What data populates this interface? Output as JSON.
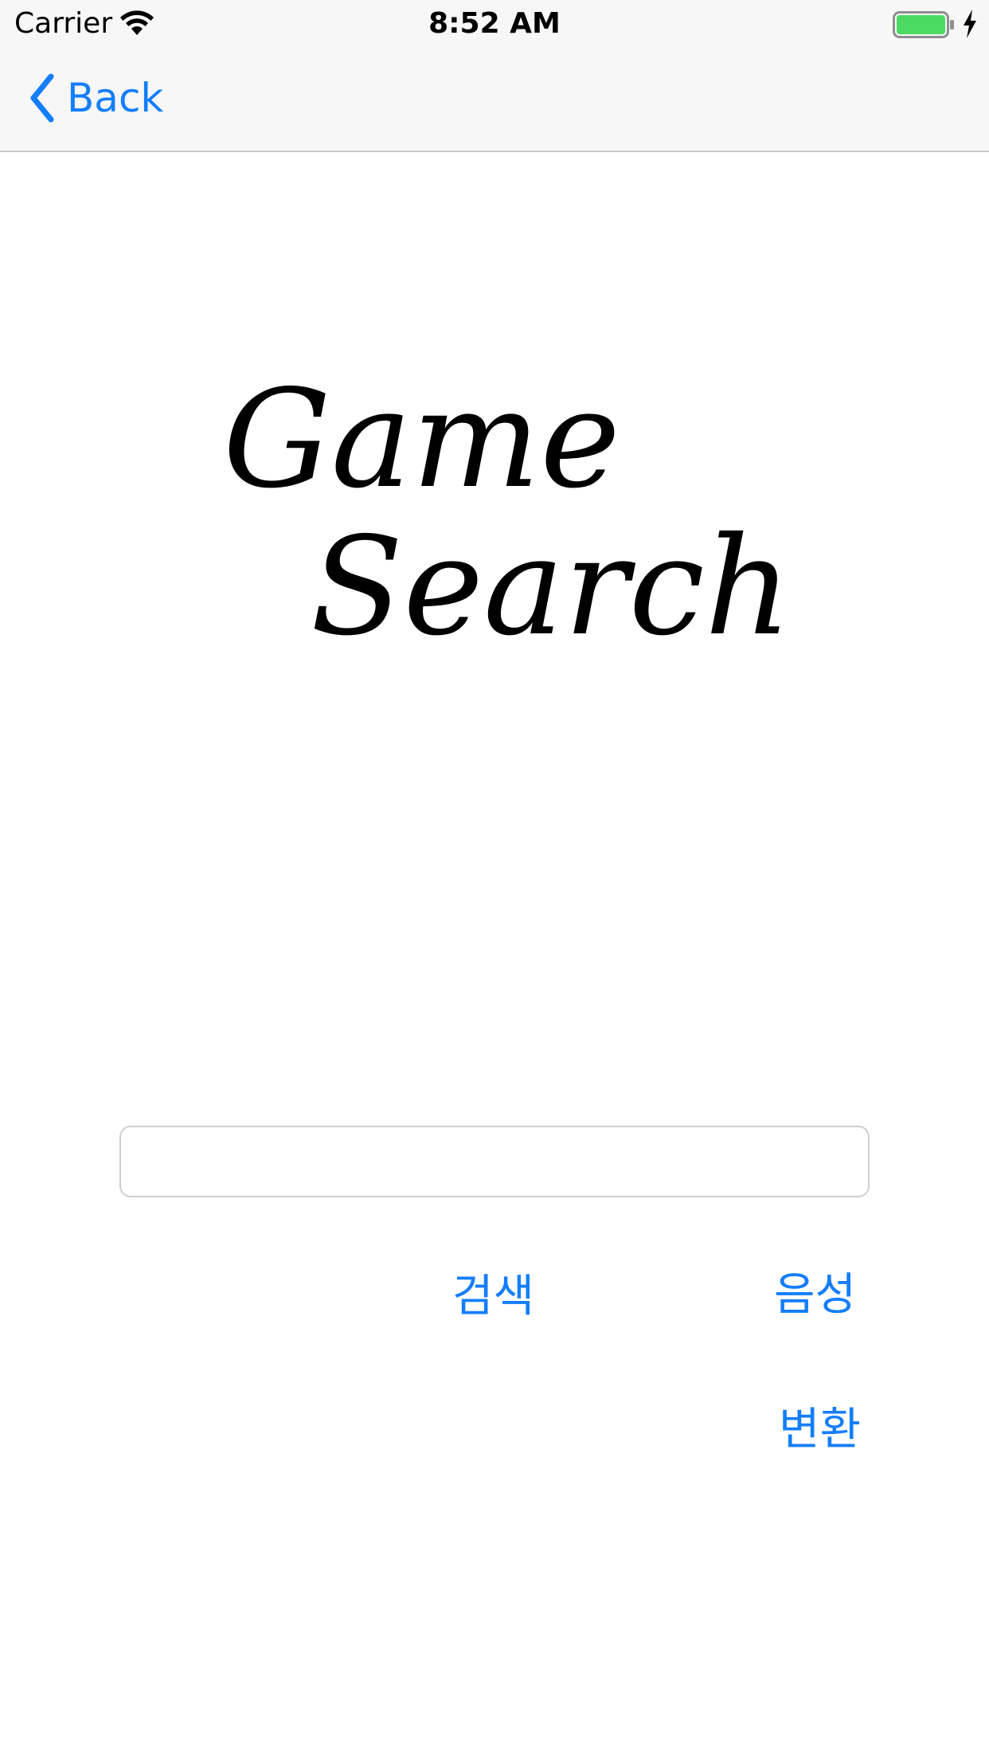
{
  "status_bar": {
    "carrier": "Carrier",
    "time": "8:52 AM",
    "wifi_icon": "wifi-icon",
    "battery_icon": "battery-full-icon",
    "charging_icon": "charging-bolt-icon",
    "battery_color": "#4cd964"
  },
  "nav": {
    "back_label": "Back",
    "back_icon": "chevron-left-icon",
    "accent_color": "#147efb"
  },
  "logo": {
    "line1": "Game",
    "line2": "Search"
  },
  "search": {
    "value": "",
    "placeholder": ""
  },
  "buttons": {
    "search_label": "검색",
    "voice_label": "음성",
    "convert_label": "변환"
  }
}
